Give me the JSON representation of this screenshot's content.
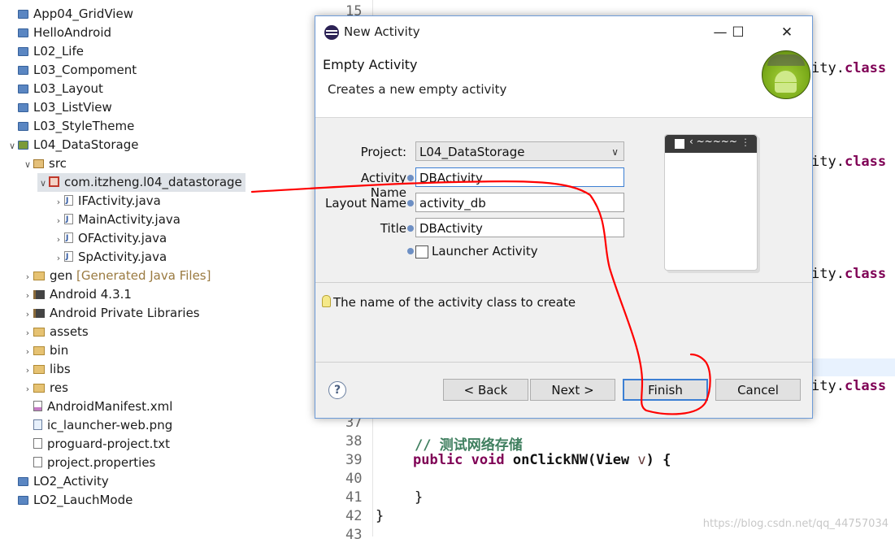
{
  "tree": {
    "items": [
      {
        "label": "App04_GridView",
        "icon": "project-icon"
      },
      {
        "label": "HelloAndroid",
        "icon": "project-icon"
      },
      {
        "label": "L02_Life",
        "icon": "project-icon"
      },
      {
        "label": "L03_Compoment",
        "icon": "project-icon"
      },
      {
        "label": "L03_Layout",
        "icon": "project-icon"
      },
      {
        "label": "L03_ListView",
        "icon": "project-icon"
      },
      {
        "label": "L03_StyleTheme",
        "icon": "project-icon"
      },
      {
        "label": "L04_DataStorage",
        "icon": "android-project-icon"
      },
      {
        "label": "src",
        "icon": "source-folder-icon"
      },
      {
        "label": "com.itzheng.l04_datastorage",
        "icon": "package-icon"
      },
      {
        "label": "IFActivity.java",
        "icon": "java-file-icon"
      },
      {
        "label": "MainActivity.java",
        "icon": "java-file-icon"
      },
      {
        "label": "OFActivity.java",
        "icon": "java-file-icon"
      },
      {
        "label": "SpActivity.java",
        "icon": "java-file-icon"
      },
      {
        "label": "gen",
        "suffix": "[Generated Java Files]",
        "icon": "folder-icon"
      },
      {
        "label": "Android 4.3.1",
        "icon": "library-icon"
      },
      {
        "label": "Android Private Libraries",
        "icon": "library-icon"
      },
      {
        "label": "assets",
        "icon": "folder-icon"
      },
      {
        "label": "bin",
        "icon": "folder-icon"
      },
      {
        "label": "libs",
        "icon": "folder-icon"
      },
      {
        "label": "res",
        "icon": "folder-icon"
      },
      {
        "label": "AndroidManifest.xml",
        "icon": "xml-file-icon"
      },
      {
        "label": "ic_launcher-web.png",
        "icon": "image-file-icon"
      },
      {
        "label": "proguard-project.txt",
        "icon": "text-file-icon"
      },
      {
        "label": "project.properties",
        "icon": "text-file-icon"
      },
      {
        "label": "LO2_Activity",
        "icon": "project-icon"
      },
      {
        "label": "LO2_LauchMode",
        "icon": "project-icon"
      }
    ]
  },
  "editor": {
    "line_numbers": [
      "15",
      "37",
      "38",
      "39",
      "40",
      "41",
      "42",
      "43"
    ],
    "fragments": [
      "ity.",
      "class"
    ],
    "comment": "// 测试网络存储",
    "kw_public": "public",
    "kw_void": "void",
    "method": "onClickNW(View",
    "param": "v",
    "rest": ") {",
    "brace_close_inner": "}",
    "brace_close_outer": "}",
    "watermark": "https://blog.csdn.net/qq_44757034"
  },
  "dialog": {
    "title": "New Activity",
    "heading": "Empty Activity",
    "description": "Creates a new empty activity",
    "fields": {
      "project_label": "Project:",
      "project_value": "L04_DataStorage",
      "activity_name_label": "Activity Name",
      "activity_name_value": "DBActivity",
      "layout_name_label": "Layout Name",
      "layout_name_value": "activity_db",
      "title_label": "Title",
      "title_value": "DBActivity",
      "launcher_label": "Launcher Activity"
    },
    "message": "The name of the activity class to create",
    "buttons": {
      "back": "< Back",
      "next": "Next >",
      "finish": "Finish",
      "cancel": "Cancel",
      "help": "?"
    },
    "window_buttons": {
      "minimize": "—",
      "maximize": "☐",
      "close": "✕"
    }
  },
  "colors": {
    "annotation": "#ff0000",
    "accent": "#3c7fd3"
  }
}
